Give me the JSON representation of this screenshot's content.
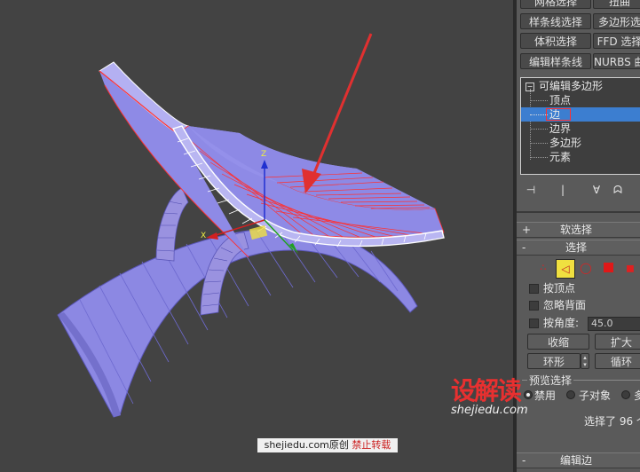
{
  "panel": {
    "top_buttons": [
      {
        "left": "网格选择",
        "right": "扭曲"
      },
      {
        "left": "样条线选择",
        "right": "多边形选"
      },
      {
        "left": "体积选择",
        "right": "FFD 选择"
      },
      {
        "left": "编辑样条线",
        "right": "NURBS 曲面"
      }
    ],
    "modifier_stack": {
      "root": "可编辑多边形",
      "items": [
        "顶点",
        "边",
        "边界",
        "多边形",
        "元素"
      ],
      "selected_index": 1
    },
    "rollouts": {
      "soft_selection": {
        "sign": "+",
        "title": "软选择"
      },
      "selection": {
        "sign": "-",
        "title": "选择"
      },
      "edit_edges": {
        "sign": "-",
        "title": "编辑边"
      }
    },
    "selection": {
      "by_vertex": "按顶点",
      "ignore_backfacing": "忽略背面",
      "by_angle": "按角度:",
      "angle_value": "45.0",
      "shrink": "收缩",
      "grow": "扩大",
      "ring": "环形",
      "loop": "循环",
      "preview_group": "预览选择",
      "preview_options": [
        "禁用",
        "子对象",
        "多"
      ],
      "preview_selected_index": 0,
      "status": "选择了 96 个"
    }
  },
  "watermark": {
    "logo_text": "设解读",
    "logo_url": "shejiedu.com",
    "bottom_prefix": "shejiedu.com原创",
    "bottom_warning": "禁止转载"
  },
  "colors": {
    "viewport_bg": "#434343",
    "panel_bg": "#5a5a5a",
    "model_fill": "#8e8ae6",
    "edge_selected": "#ff3030",
    "highlight": "#3c7ed0",
    "arrow": "#e03030"
  }
}
